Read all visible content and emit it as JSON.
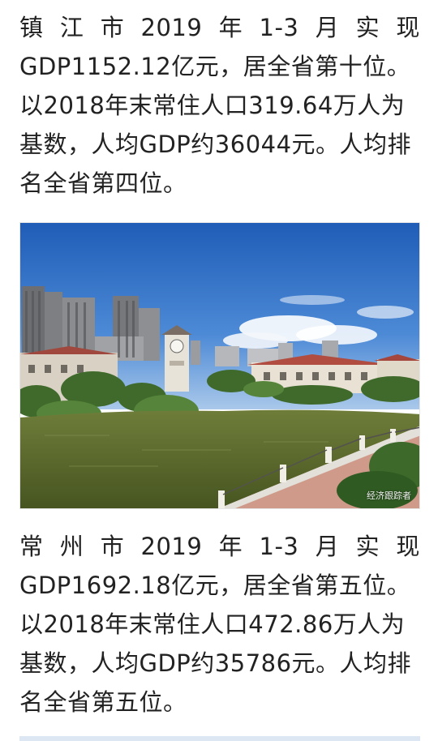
{
  "article": {
    "para1": {
      "line1": [
        "镇",
        "江",
        "市",
        "2019",
        "年",
        "1-3",
        "月",
        "实",
        "现"
      ],
      "line2": "GDP1152.12亿元，居全省第十位。",
      "line3": "以2018年末常住人口319.64万人为",
      "line4": "基数，人均GDP约36044元。人均排",
      "line5": "名全省第四位。"
    },
    "photo": {
      "watermark": "经济跟踪者"
    },
    "para2": {
      "line1": [
        "常",
        "州",
        "市",
        "2019",
        "年",
        "1-3",
        "月",
        "实",
        "现"
      ],
      "line2": "GDP1692.18亿元，居全省第五位。",
      "line3": "以2018年末常住人口472.86万人为",
      "line4": "基数，人均GDP约35786元。人均排",
      "line5": "名全省第五位。"
    }
  },
  "colors": {
    "text": "#222222",
    "sky": "#2f6fc4",
    "water": "#5a6a2c"
  }
}
